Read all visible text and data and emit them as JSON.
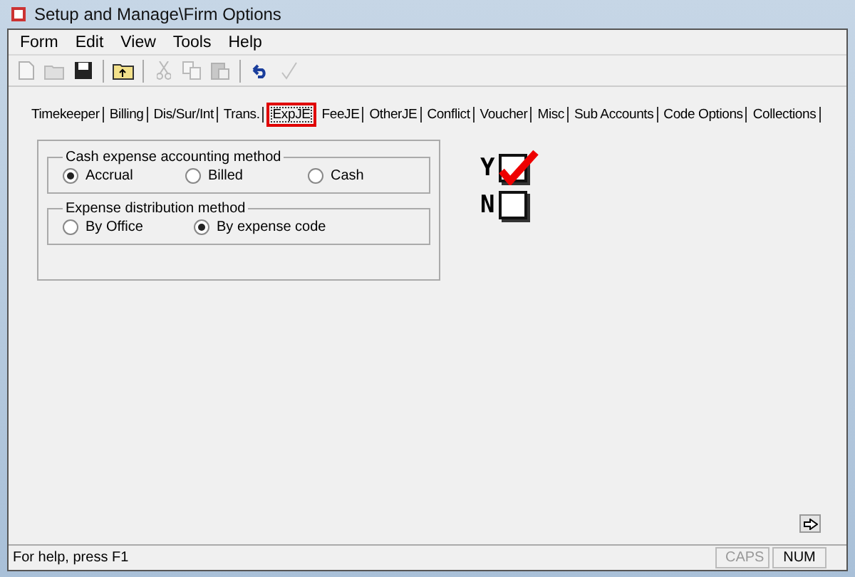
{
  "window": {
    "title": "Setup and Manage\\Firm Options"
  },
  "menu": [
    "Form",
    "Edit",
    "View",
    "Tools",
    "Help"
  ],
  "toolbar": [
    {
      "kind": "new",
      "disabled": true
    },
    {
      "kind": "open",
      "disabled": true
    },
    {
      "kind": "save",
      "disabled": false
    },
    {
      "kind": "sep"
    },
    {
      "kind": "folder",
      "disabled": false
    },
    {
      "kind": "sep"
    },
    {
      "kind": "cut",
      "disabled": true
    },
    {
      "kind": "copy",
      "disabled": true
    },
    {
      "kind": "paste",
      "disabled": true
    },
    {
      "kind": "sep"
    },
    {
      "kind": "undo",
      "disabled": false
    },
    {
      "kind": "spell",
      "disabled": true
    }
  ],
  "tabs": [
    {
      "label": "Timekeeper",
      "selected": false
    },
    {
      "label": "Billing",
      "selected": false
    },
    {
      "label": "Dis/Sur/Int",
      "selected": false
    },
    {
      "label": "Trans.",
      "selected": false
    },
    {
      "label": "ExpJE",
      "selected": true
    },
    {
      "label": "FeeJE",
      "selected": false
    },
    {
      "label": "OtherJE",
      "selected": false
    },
    {
      "label": "Conflict",
      "selected": false
    },
    {
      "label": "Voucher",
      "selected": false
    },
    {
      "label": "Misc",
      "selected": false
    },
    {
      "label": "Sub Accounts",
      "selected": false
    },
    {
      "label": "Code Options",
      "selected": false
    },
    {
      "label": "Collections",
      "selected": false
    }
  ],
  "groups": [
    {
      "title": "Cash expense accounting method",
      "options": [
        {
          "label": "Accrual",
          "selected": true
        },
        {
          "label": "Billed",
          "selected": false
        },
        {
          "label": "Cash",
          "selected": false
        }
      ]
    },
    {
      "title": "Expense distribution method",
      "options": [
        {
          "label": "By Office",
          "selected": false
        },
        {
          "label": "By expense code",
          "selected": true
        }
      ]
    }
  ],
  "yes_no": {
    "yes_label": "Y",
    "no_label": "N",
    "yes_checked": true,
    "no_checked": false
  },
  "status_bar": {
    "help": "For help, press F1",
    "indicators": [
      {
        "label": "CAPS",
        "on": false
      },
      {
        "label": "NUM",
        "on": true
      }
    ]
  }
}
